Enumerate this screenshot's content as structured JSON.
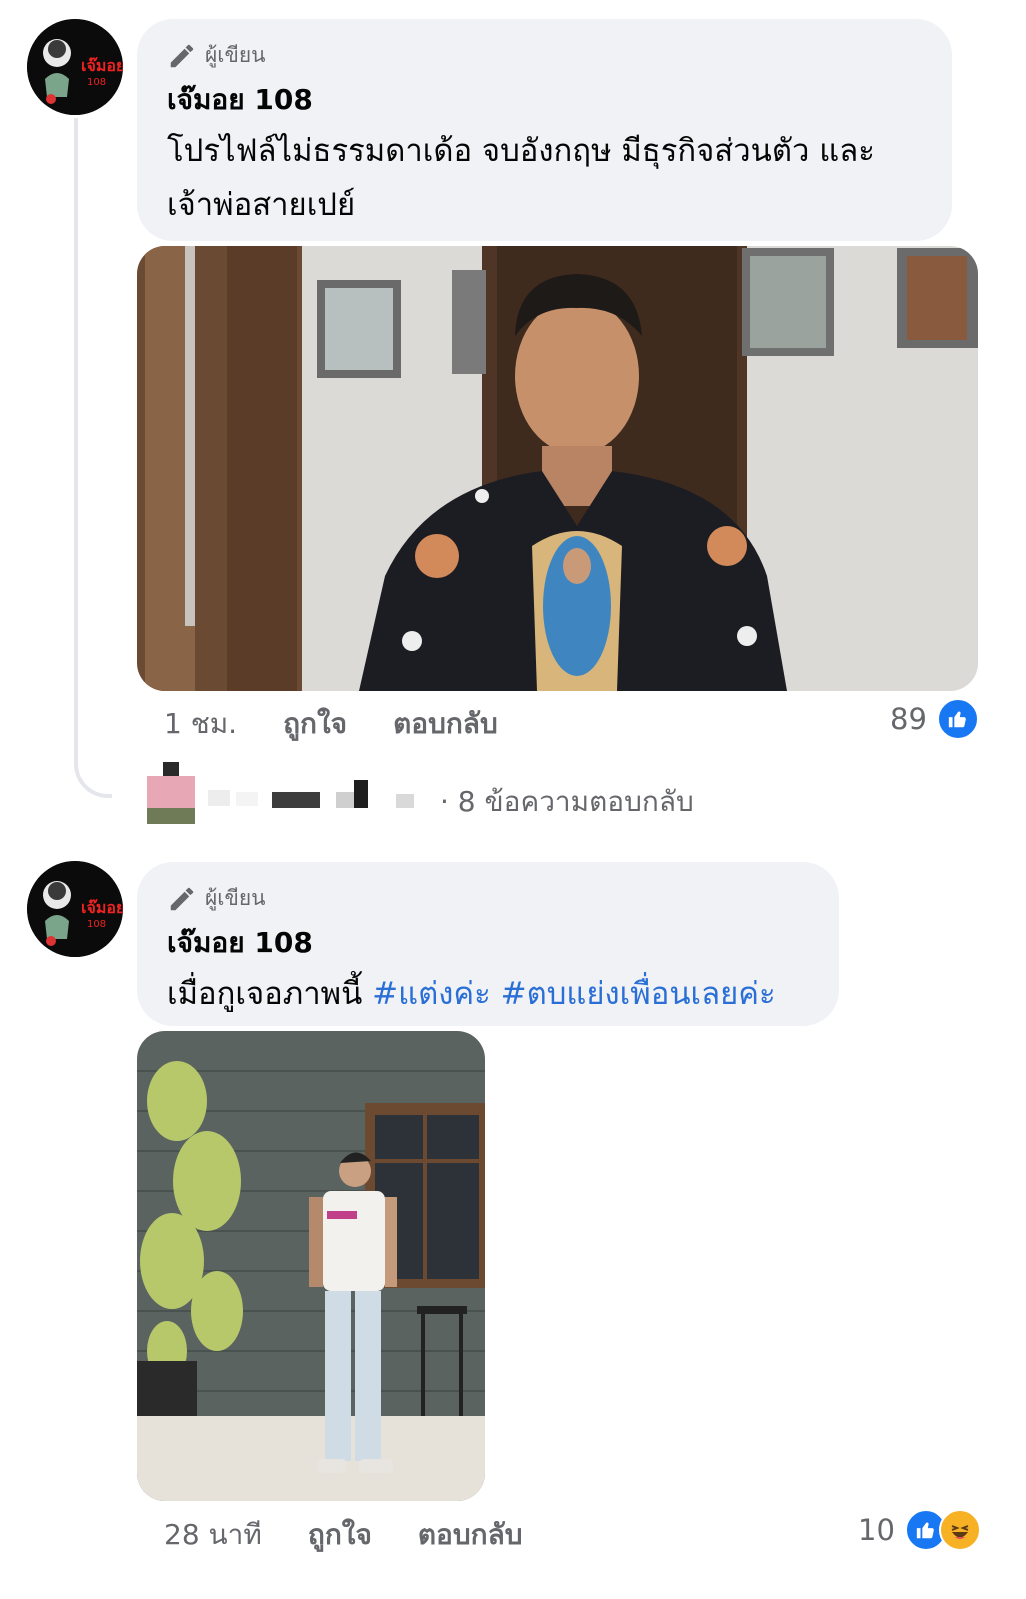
{
  "comments": [
    {
      "author_badge": "ผู้เขียน",
      "author_name": "เจ๊มอย 108",
      "avatar_text": "เจ๊มอย",
      "avatar_num": "108",
      "text": "โปรไฟล์ไม่ธรรมดาเด้อ จบอังกฤษ มีธุรกิจส่วนตัว และ เจ้าพ่อสายเปย์",
      "time": "1 ชม.",
      "like_label": "ถูกใจ",
      "reply_label": "ตอบกลับ",
      "reaction_count": "89",
      "reactions": [
        "like-icon"
      ]
    },
    {
      "author_badge": "ผู้เขียน",
      "author_name": "เจ๊มอย 108",
      "avatar_text": "เจ๊มอย",
      "avatar_num": "108",
      "text_plain": "เมื่อกูเจอภาพนี้ ",
      "hashtags": [
        "#แต่งค่ะ",
        "#ตบแย่งเพื่อนเลยค่ะ"
      ],
      "time": "28 นาที",
      "like_label": "ถูกใจ",
      "reply_label": "ตอบกลับ",
      "reaction_count": "10",
      "reactions": [
        "like-icon",
        "haha-icon"
      ]
    }
  ],
  "replies_link": "· 8 ข้อความตอบกลับ",
  "colors": {
    "bubble": "#f0f2f5",
    "meta": "#65676b",
    "hashtag": "#2a6fd6",
    "like": "#1877f2",
    "haha": "#f7b125"
  }
}
